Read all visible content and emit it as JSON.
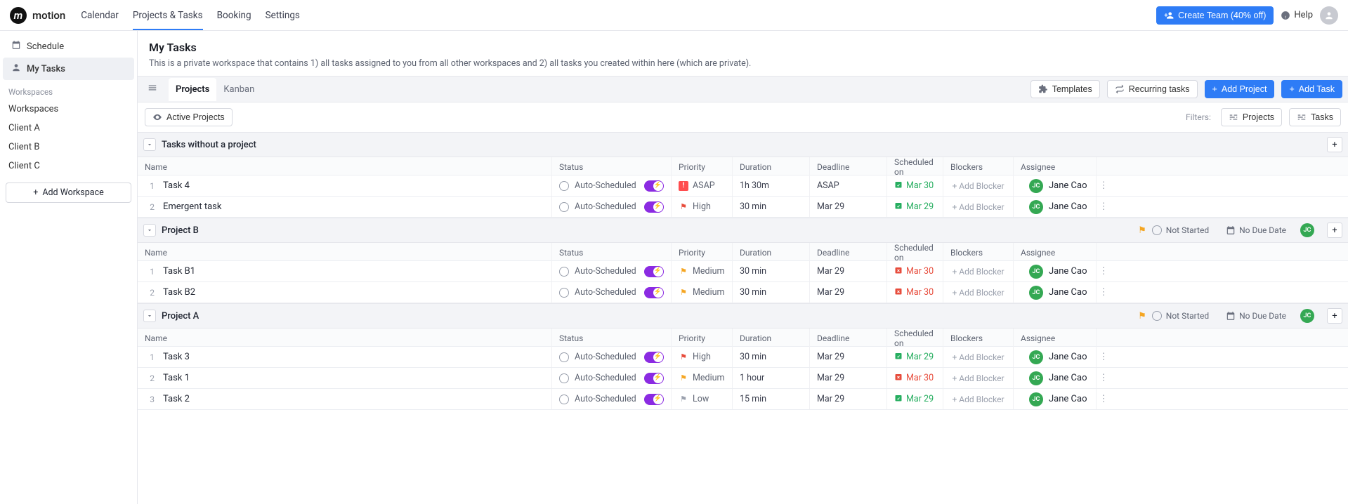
{
  "brand": "motion",
  "nav": {
    "items": [
      "Calendar",
      "Projects & Tasks",
      "Booking",
      "Settings"
    ],
    "active": 1
  },
  "topbar": {
    "create_team": "Create Team (40% off)",
    "help": "Help"
  },
  "sidebar": {
    "items": [
      {
        "icon": "calendar",
        "label": "Schedule"
      },
      {
        "icon": "person",
        "label": "My Tasks"
      }
    ],
    "active": 1,
    "workspaces_label": "Workspaces",
    "workspaces": [
      "Workspaces",
      "Client A",
      "Client B",
      "Client C"
    ],
    "add_workspace": "Add Workspace"
  },
  "page": {
    "title": "My Tasks",
    "subtitle": "This is a private workspace that contains 1) all tasks assigned to you from all other workspaces and 2) all tasks you created within here (which are private)."
  },
  "toolbar": {
    "tabs": [
      "Projects",
      "Kanban"
    ],
    "active_tab": 0,
    "templates": "Templates",
    "recurring": "Recurring tasks",
    "add_project": "Add Project",
    "add_task": "Add Task"
  },
  "subbar": {
    "active_projects": "Active Projects",
    "filters_label": "Filters:",
    "filter_projects": "Projects",
    "filter_tasks": "Tasks"
  },
  "columns": {
    "name": "Name",
    "status": "Status",
    "priority": "Priority",
    "duration": "Duration",
    "deadline": "Deadline",
    "scheduled": "Scheduled on",
    "blockers": "Blockers",
    "assignee": "Assignee"
  },
  "assignee": {
    "name": "Jane Cao",
    "initials": "JC"
  },
  "labels": {
    "auto_scheduled": "Auto-Scheduled",
    "add_blocker": "+ Add Blocker",
    "not_started": "Not Started",
    "no_due_date": "No Due Date"
  },
  "groups": [
    {
      "title": "Tasks without a project",
      "show_project_status": false,
      "tasks": [
        {
          "idx": 1,
          "name": "Task 4",
          "priority": "ASAP",
          "duration": "1h 30m",
          "deadline": "ASAP",
          "scheduled": "Mar 30",
          "sched_color": "green"
        },
        {
          "idx": 2,
          "name": "Emergent task",
          "priority": "High",
          "duration": "30 min",
          "deadline": "Mar 29",
          "scheduled": "Mar 29",
          "sched_color": "green"
        }
      ]
    },
    {
      "title": "Project B",
      "show_project_status": true,
      "tasks": [
        {
          "idx": 1,
          "name": "Task B1",
          "priority": "Medium",
          "duration": "30 min",
          "deadline": "Mar 29",
          "scheduled": "Mar 30",
          "sched_color": "red"
        },
        {
          "idx": 2,
          "name": "Task B2",
          "priority": "Medium",
          "duration": "30 min",
          "deadline": "Mar 29",
          "scheduled": "Mar 30",
          "sched_color": "red"
        }
      ]
    },
    {
      "title": "Project A",
      "show_project_status": true,
      "tasks": [
        {
          "idx": 1,
          "name": "Task 3",
          "priority": "High",
          "duration": "30 min",
          "deadline": "Mar 29",
          "scheduled": "Mar 29",
          "sched_color": "green"
        },
        {
          "idx": 2,
          "name": "Task 1",
          "priority": "Medium",
          "duration": "1 hour",
          "deadline": "Mar 29",
          "scheduled": "Mar 30",
          "sched_color": "red"
        },
        {
          "idx": 3,
          "name": "Task 2",
          "priority": "Low",
          "duration": "15 min",
          "deadline": "Mar 29",
          "scheduled": "Mar 29",
          "sched_color": "green"
        }
      ]
    }
  ]
}
